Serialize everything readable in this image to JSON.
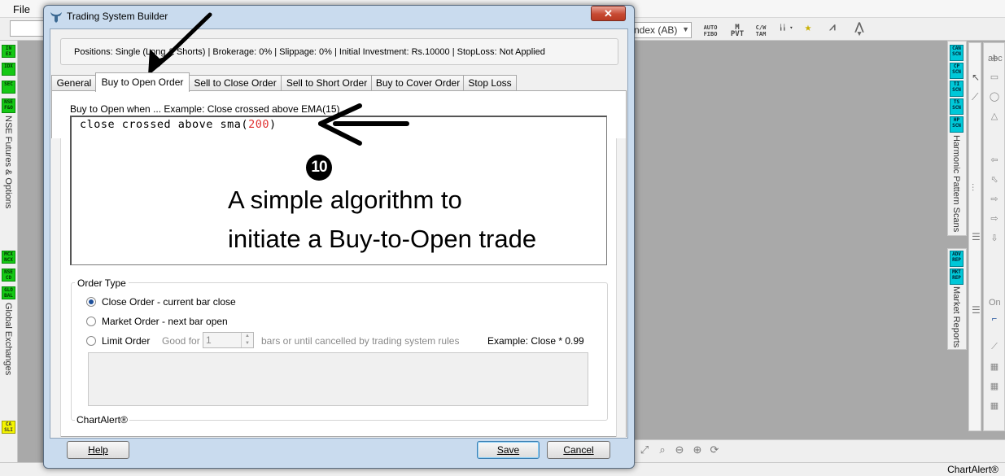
{
  "app": {
    "menu_file": "File",
    "index_combo": "ndex (AB)",
    "status_text": "ChartAlert®",
    "toolbar_icons": [
      "AUTO FIBO",
      "M PVT",
      "C/W TAM",
      "TNS",
      "ZIG",
      "ANDR"
    ],
    "left_buttons": [
      "IN EX",
      "IDX",
      "SEC",
      "NSE F&O",
      "MCX NCX",
      "NSE CD",
      "GLO BAL",
      "CA SLI"
    ],
    "left_label_1": "NSE Futures & Options",
    "left_label_2": "Global Exchanges",
    "right_buttons_1": [
      "CAN SCN",
      "CP SCN",
      "TI SCN",
      "TS SCN",
      "HP SCN"
    ],
    "right_label_1": "Harmonic Pattern Scans",
    "right_buttons_2": [
      "ADV REP",
      "MKT REP"
    ],
    "right_label_2": "Market Reports",
    "draw_tools_text": [
      "abc",
      "On"
    ]
  },
  "dialog": {
    "title": "Trading System Builder",
    "close_label": "✕",
    "info": "Positions: Single (Long & Shorts)  |  Brokerage: 0%  |  Slippage: 0%  |  Initial Investment: Rs.10000  |  StopLoss: Not Applied",
    "tabs": [
      {
        "label": "General"
      },
      {
        "label": "Buy to Open Order"
      },
      {
        "label": "Sell to Close Order"
      },
      {
        "label": "Sell to Short Order"
      },
      {
        "label": "Buy to Cover Order"
      },
      {
        "label": "Stop Loss"
      }
    ],
    "active_tab": "Buy to Open Order",
    "condition_label": "Buy to Open when ... Example: Close crossed above EMA(15)",
    "condition_code_prefix": "close crossed above sma(",
    "condition_code_number": "200",
    "condition_code_suffix": ")",
    "order_type": {
      "legend": "Order Type",
      "options": [
        {
          "label": "Close Order - current bar close",
          "checked": true
        },
        {
          "label": "Market Order -  next bar open",
          "checked": false
        },
        {
          "label": "Limit Order",
          "checked": false
        }
      ],
      "good_for_label": "Good for",
      "good_for_value": "1",
      "bars_until_label": "bars or until cancelled by trading system rules",
      "limit_example": "Example: Close * 0.99"
    },
    "group_footer": "ChartAlert®",
    "buttons": {
      "help": "Help",
      "save": "Save",
      "cancel": "Cancel"
    }
  },
  "annotation": {
    "step_number": "10",
    "line1": "A simple algorithm to",
    "line2": "initiate a Buy-to-Open trade"
  }
}
